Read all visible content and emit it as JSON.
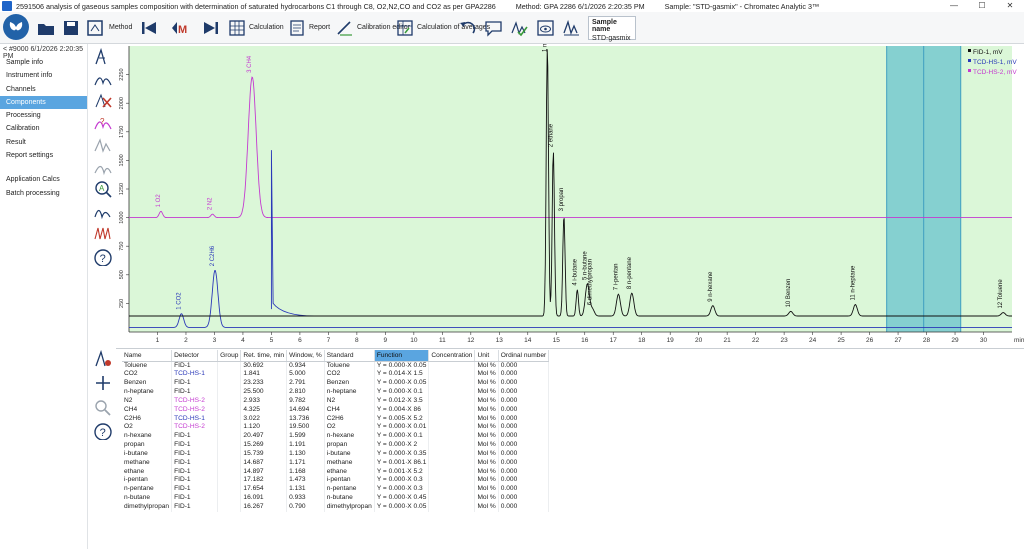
{
  "window": {
    "title": "2591506 analysis of gaseous samples composition with determination of saturated hydrocarbons C1 through C8, O2,N2,CO and CO2 as per GPA2286",
    "method": "Method: GPA 2286 6/1/2026 2:20:35 PM",
    "sample": "Sample: \"STD-gasmix\" - Chromatec Analytic 3™",
    "minimize": "—",
    "maximize": "☐",
    "close": "✕"
  },
  "toolbar": {
    "method_label": "Method",
    "calculation_label": "Calculation",
    "report_label": "Report",
    "calibration_editor_label": "Calibration editor",
    "calc_averages_label": "Calculation of averages",
    "sample_name_header": "Sample name",
    "sample_name_value": "STD-gasmix"
  },
  "sidebar": {
    "header": "< #9000 6/1/2026 2:20:35 PM",
    "items": [
      {
        "label": "Sample info"
      },
      {
        "label": "Instrument info"
      },
      {
        "label": "Channels"
      },
      {
        "label": "Components"
      },
      {
        "label": "Processing"
      },
      {
        "label": "Calibration"
      },
      {
        "label": "Result"
      },
      {
        "label": "Report settings"
      }
    ],
    "items2": [
      {
        "label": "Application Calcs"
      },
      {
        "label": "Batch processing"
      }
    ],
    "active_index": 3
  },
  "colors": {
    "chart_bg": "#dbf7d8",
    "band": "#76c9cf",
    "fid": "#111111",
    "tcd1": "#2a38b8",
    "tcd2": "#c43ad0",
    "accent": "#5aa5e0"
  },
  "chart_data": {
    "type": "line",
    "xlabel": "min",
    "xlim": [
      0,
      31
    ],
    "xticks": [
      1,
      2,
      3,
      4,
      5,
      6,
      7,
      8,
      9,
      10,
      11,
      12,
      13,
      14,
      15,
      16,
      17,
      18,
      19,
      20,
      21,
      22,
      23,
      24,
      25,
      26,
      27,
      28,
      29,
      30
    ],
    "y_left_ticks": [
      250,
      500,
      750,
      1000,
      1250,
      1500,
      1750,
      2000,
      2250
    ],
    "y_left_range": [
      0,
      2500
    ],
    "legend_position": "top-right",
    "shaded_range": [
      26.6,
      29.2
    ],
    "shaded_divider": 27.9,
    "series": [
      {
        "name": "FID-1, mV",
        "detector": "FID-1",
        "baseline": 140
      },
      {
        "name": "TCD-HS-1, mV",
        "detector": "TCD-HS-1",
        "baseline": 40
      },
      {
        "name": "TCD-HS-2, mV",
        "detector": "TCD-HS-2",
        "baseline": 1000
      }
    ],
    "peaks": [
      {
        "label": "1 O2",
        "series": "TCD-HS-2",
        "x": 1.12,
        "y": 1055
      },
      {
        "label": "2 N2",
        "series": "TCD-HS-2",
        "x": 2.933,
        "y": 1030
      },
      {
        "label": "3 CH4",
        "series": "TCD-HS-2",
        "x": 4.325,
        "y": 2230
      },
      {
        "label": "1 CO2",
        "series": "TCD-HS-1",
        "x": 1.841,
        "y": 160
      },
      {
        "label": "2 C2H6",
        "series": "TCD-HS-1",
        "x": 3.022,
        "y": 540
      },
      {
        "label": "1 methane",
        "series": "FID-1",
        "x": 14.687,
        "y": 2500
      },
      {
        "label": "2 ethane",
        "series": "FID-1",
        "x": 14.897,
        "y": 1580
      },
      {
        "label": "3 propan",
        "series": "FID-1",
        "x": 15.269,
        "y": 1020
      },
      {
        "label": "4 i-butane",
        "series": "FID-1",
        "x": 15.739,
        "y": 370
      },
      {
        "label": "5 n-butane",
        "series": "FID-1",
        "x": 16.091,
        "y": 420
      },
      {
        "label": "6 dimethylpropan",
        "series": "FID-1",
        "x": 16.267,
        "y": 200
      },
      {
        "label": "7 i-pentan",
        "series": "FID-1",
        "x": 17.182,
        "y": 330
      },
      {
        "label": "8 n-pentane",
        "series": "FID-1",
        "x": 17.654,
        "y": 340
      },
      {
        "label": "9 n-hexane",
        "series": "FID-1",
        "x": 20.497,
        "y": 230
      },
      {
        "label": "10 Benzen",
        "series": "FID-1",
        "x": 23.233,
        "y": 180
      },
      {
        "label": "11 n-heptane",
        "series": "FID-1",
        "x": 25.5,
        "y": 240
      },
      {
        "label": "12 Toluene",
        "series": "FID-1",
        "x": 30.692,
        "y": 170
      }
    ]
  },
  "table": {
    "headers": [
      "Name",
      "Detector",
      "Group",
      "Ret. time, min",
      "Window, %",
      "Standard",
      "Function",
      "Concentration",
      "Unit",
      "Ordinal number"
    ],
    "rows": [
      [
        "Toluene",
        "FID-1",
        "",
        "30.692",
        "0.934",
        "Toluene",
        "Y = 0.000·X 0.05",
        "",
        "Mol %",
        "0.000"
      ],
      [
        "CO2",
        "TCD-HS-1",
        "",
        "1.841",
        "5.000",
        "CO2",
        "Y = 0.014·X 1.5",
        "",
        "Mol %",
        "0.000"
      ],
      [
        "Benzen",
        "FID-1",
        "",
        "23.233",
        "2.791",
        "Benzen",
        "Y = 0.000·X 0.05",
        "",
        "Mol %",
        "0.000"
      ],
      [
        "n-heptane",
        "FID-1",
        "",
        "25.500",
        "2.810",
        "n-heptane",
        "Y = 0.000·X 0.1",
        "",
        "Mol %",
        "0.000"
      ],
      [
        "N2",
        "TCD-HS-2",
        "",
        "2.933",
        "9.782",
        "N2",
        "Y = 0.012·X 3.5",
        "",
        "Mol %",
        "0.000"
      ],
      [
        "CH4",
        "TCD-HS-2",
        "",
        "4.325",
        "14.694",
        "CH4",
        "Y = 0.004·X 86",
        "",
        "Mol %",
        "0.000"
      ],
      [
        "C2H6",
        "TCD-HS-1",
        "",
        "3.022",
        "13.736",
        "C2H6",
        "Y = 0.005·X 5.2",
        "",
        "Mol %",
        "0.000"
      ],
      [
        "O2",
        "TCD-HS-2",
        "",
        "1.120",
        "19.500",
        "O2",
        "Y = 0.000·X 0.01",
        "",
        "Mol %",
        "0.000"
      ],
      [
        "n-hexane",
        "FID-1",
        "",
        "20.497",
        "1.599",
        "n-hexane",
        "Y = 0.000·X 0.1",
        "",
        "Mol %",
        "0.000"
      ],
      [
        "propan",
        "FID-1",
        "",
        "15.269",
        "1.191",
        "propan",
        "Y = 0.000·X 2",
        "",
        "Mol %",
        "0.000"
      ],
      [
        "i-butane",
        "FID-1",
        "",
        "15.739",
        "1.130",
        "i-butane",
        "Y = 0.000·X 0.35",
        "",
        "Mol %",
        "0.000"
      ],
      [
        "methane",
        "FID-1",
        "",
        "14.687",
        "1.171",
        "methane",
        "Y = 0.001·X 86.1",
        "",
        "Mol %",
        "0.000"
      ],
      [
        "ethane",
        "FID-1",
        "",
        "14.897",
        "1.168",
        "ethane",
        "Y = 0.001·X 5.2",
        "",
        "Mol %",
        "0.000"
      ],
      [
        "i-pentan",
        "FID-1",
        "",
        "17.182",
        "1.473",
        "i-pentan",
        "Y = 0.000·X 0.3",
        "",
        "Mol %",
        "0.000"
      ],
      [
        "n-pentane",
        "FID-1",
        "",
        "17.654",
        "1.131",
        "n-pentane",
        "Y = 0.000·X 0.3",
        "",
        "Mol %",
        "0.000"
      ],
      [
        "n-butane",
        "FID-1",
        "",
        "16.091",
        "0.933",
        "n-butane",
        "Y = 0.000·X 0.45",
        "",
        "Mol %",
        "0.000"
      ],
      [
        "dimethylpropan",
        "FID-1",
        "",
        "16.267",
        "0.790",
        "dimethylpropan",
        "Y = 0.000·X 0.05",
        "",
        "Mol %",
        "0.000"
      ]
    ]
  }
}
